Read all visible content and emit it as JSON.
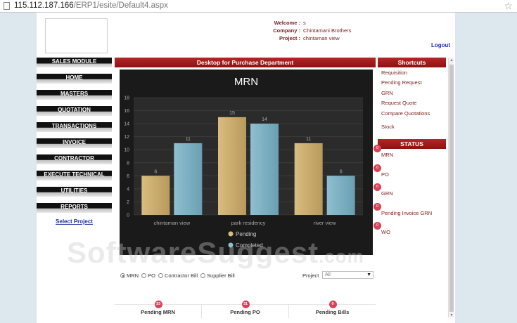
{
  "browser": {
    "url_host": "115.112.187.166",
    "url_path": "/ERP1/esite/Default4.aspx"
  },
  "header": {
    "welcome_label": "Welcome :",
    "welcome_value": "s",
    "company_label": "Company :",
    "company_value": "Chintamani Brothers",
    "project_label": "Project :",
    "project_value": "chintaman view",
    "logout": "Logout"
  },
  "nav": {
    "items": [
      "SALES MODULE",
      "HOME",
      "MASTERS",
      "QUOTATION",
      "TRANSACTIONS",
      "INVOICE",
      "CONTRACTOR",
      "EXECUTE TECHNICAL",
      "UTILITIES",
      "REPORTS"
    ],
    "select_project": "Select Project"
  },
  "main": {
    "title": "Desktop for Purchase Department",
    "radios": [
      {
        "label": "MRN",
        "selected": true
      },
      {
        "label": "PO",
        "selected": false
      },
      {
        "label": "Contractor Bill",
        "selected": false
      },
      {
        "label": "Supplier Bill",
        "selected": false
      }
    ],
    "project_label": "Project",
    "project_value": "All",
    "pending": [
      {
        "label": "Pending MRN",
        "count": "33"
      },
      {
        "label": "Pending PO",
        "count": "31"
      },
      {
        "label": "Pending Bills",
        "count": "0"
      }
    ]
  },
  "shortcuts": {
    "title": "Shortcuts",
    "items": [
      "Requisition",
      "Pending Request",
      "GRN",
      "Request Quote",
      "Compare Quotations",
      "Stock"
    ]
  },
  "status": {
    "title": "STATUS",
    "items": [
      {
        "label": "MRN",
        "count": "0"
      },
      {
        "label": "PO",
        "count": "0"
      },
      {
        "label": "GRN",
        "count": "0"
      },
      {
        "label": "Pending Invoice GRN",
        "count": "0"
      },
      {
        "label": "WO",
        "count": "0"
      }
    ]
  },
  "watermark": {
    "text": "SoftwareSuggest",
    "suffix": ".com"
  },
  "colors": {
    "brand_red": "#a11c1c",
    "pending": "#d9bc7f",
    "completed": "#8fbfd0",
    "badge": "#d84356"
  },
  "chart_data": {
    "type": "bar",
    "title": "MRN",
    "categories": [
      "chintaman view",
      "park residency",
      "river view"
    ],
    "series": [
      {
        "name": "Pending",
        "values": [
          6,
          15,
          11
        ]
      },
      {
        "name": "Completed",
        "values": [
          11,
          14,
          6
        ]
      }
    ],
    "ylim": [
      0,
      18
    ],
    "yticks": [
      0,
      2,
      4,
      6,
      8,
      10,
      12,
      14,
      16,
      18
    ],
    "grid": true,
    "legend": "bottom"
  }
}
